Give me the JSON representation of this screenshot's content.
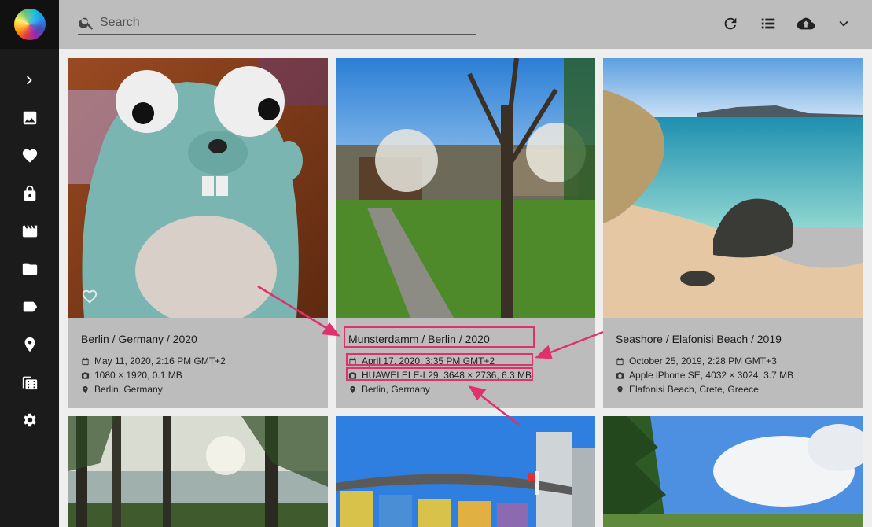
{
  "app": {
    "logo": "rainbow-logo",
    "search": {
      "placeholder": "Search",
      "value": ""
    }
  },
  "sidebar": {
    "items": [
      {
        "name": "expand",
        "icon": "chevron-right-icon"
      },
      {
        "name": "photos",
        "icon": "image-icon"
      },
      {
        "name": "favorites",
        "icon": "heart-icon"
      },
      {
        "name": "private",
        "icon": "lock-icon"
      },
      {
        "name": "videos",
        "icon": "movie-icon"
      },
      {
        "name": "folders",
        "icon": "folder-icon"
      },
      {
        "name": "labels",
        "icon": "label-icon"
      },
      {
        "name": "places",
        "icon": "map-pin-icon"
      },
      {
        "name": "library",
        "icon": "film-folder-icon"
      },
      {
        "name": "settings",
        "icon": "gear-icon"
      }
    ]
  },
  "toolbar": {
    "buttons": [
      {
        "name": "refresh",
        "icon": "refresh-icon"
      },
      {
        "name": "list-view",
        "icon": "list-icon"
      },
      {
        "name": "upload",
        "icon": "cloud-upload-icon"
      },
      {
        "name": "more",
        "icon": "chevron-down-icon"
      }
    ]
  },
  "cards": [
    {
      "title": "Berlin / Germany / 2020",
      "date": "May 11, 2020, 2:16 PM GMT+2",
      "camera": "1080 × 1920, 0.1 MB",
      "location": "Berlin, Germany",
      "photo": "plush-gopher-toy"
    },
    {
      "title": "Munsterdamm / Berlin / 2020",
      "date": "April 17, 2020, 3:35 PM GMT+2",
      "camera": "HUAWEI ELE-L29, 3648 × 2736, 6.3 MB",
      "location": "Berlin, Germany",
      "photo": "garden-path-tree"
    },
    {
      "title": "Seashore / Elafonisi Beach / 2019",
      "date": "October 25, 2019, 2:28 PM GMT+3",
      "camera": "Apple iPhone SE, 4032 × 3024, 3.7 MB",
      "location": "Elafonisi Beach, Crete, Greece",
      "photo": "beach-rocks-sea"
    },
    {
      "photo": "forest-lake"
    },
    {
      "photo": "painted-silos"
    },
    {
      "photo": "trees-clouds"
    }
  ],
  "colors": {
    "sidebar": "#1b1b1b",
    "topbar": "#bdbdbd",
    "card": "#bcbcbc",
    "highlight": "#e0306e"
  }
}
